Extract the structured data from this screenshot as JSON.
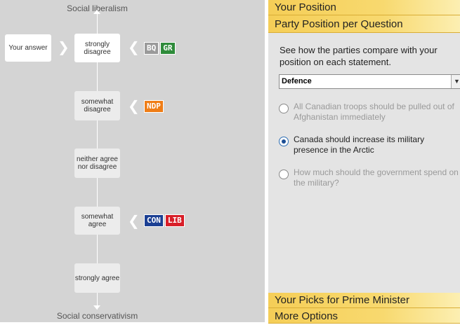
{
  "spectrum": {
    "top_label": "Social liberalism",
    "bottom_label": "Social conservativism",
    "your_answer_label": "Your answer",
    "positions": [
      {
        "label": "strongly disagree"
      },
      {
        "label": "somewhat disagree"
      },
      {
        "label": "neither agree nor disagree"
      },
      {
        "label": "somewhat agree"
      },
      {
        "label": "strongly agree"
      }
    ],
    "parties": {
      "bq": {
        "label": "BQ",
        "color": "#9a9a9a"
      },
      "gr": {
        "label": "GR",
        "color": "#2e8b3a"
      },
      "ndp": {
        "label": "NDP",
        "color": "#ef7d16"
      },
      "con": {
        "label": "CON",
        "color": "#1b3f93"
      },
      "lib": {
        "label": "LIB",
        "color": "#d81e28"
      }
    }
  },
  "panel": {
    "your_position": "Your Position",
    "party_position": "Party Position per Question",
    "intro": "See how the parties compare with your position on each statement.",
    "topic_select": {
      "value": "Defence"
    },
    "questions": [
      {
        "text": "All Canadian troops should be pulled out of Afghanistan immediately",
        "selected": false
      },
      {
        "text": "Canada should increase its military presence in the Arctic",
        "selected": true
      },
      {
        "text": "How much should the government spend on the military?",
        "selected": false
      }
    ],
    "picks_pm": "Your Picks for Prime Minister",
    "more_options": "More Options"
  }
}
